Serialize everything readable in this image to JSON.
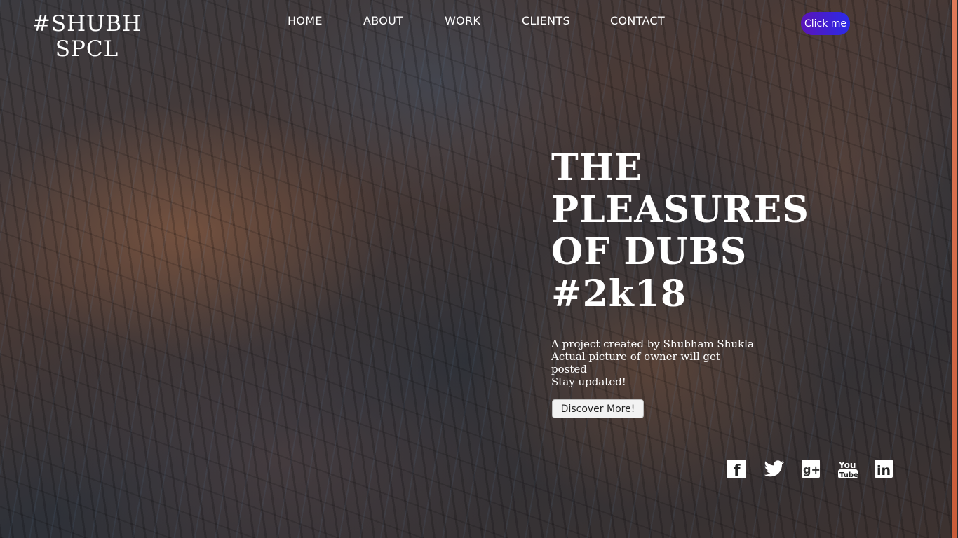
{
  "brand": {
    "logo_line1": "#SHUBH",
    "logo_line2": "SPCL"
  },
  "nav": {
    "items": [
      {
        "label": "HOME"
      },
      {
        "label": "ABOUT"
      },
      {
        "label": "WORK"
      },
      {
        "label": "CLIENTS"
      },
      {
        "label": "CONTACT"
      }
    ],
    "cta_label": "Click me"
  },
  "hero": {
    "title_lines": [
      "THE",
      "PLEASURES",
      "OF DUBS",
      "#2k18"
    ],
    "description_lines": [
      "A project created by Shubham Shukla",
      "Actual picture of owner will get",
      "posted",
      "Stay updated!"
    ],
    "button_label": "Discover More!"
  },
  "social": {
    "icons": [
      "facebook-icon",
      "twitter-icon",
      "google-plus-icon",
      "youtube-icon",
      "linkedin-icon"
    ],
    "youtube_text_top": "You",
    "youtube_text_bottom": "Tube",
    "linkedin_text": "in",
    "google_text": "g+",
    "facebook_text": "f"
  },
  "colors": {
    "cta_gradient_start": "#5b14b8",
    "cta_gradient_end": "#2a2be8",
    "scrollbar_thumb": "#e07a5a",
    "text": "#ffffff"
  }
}
